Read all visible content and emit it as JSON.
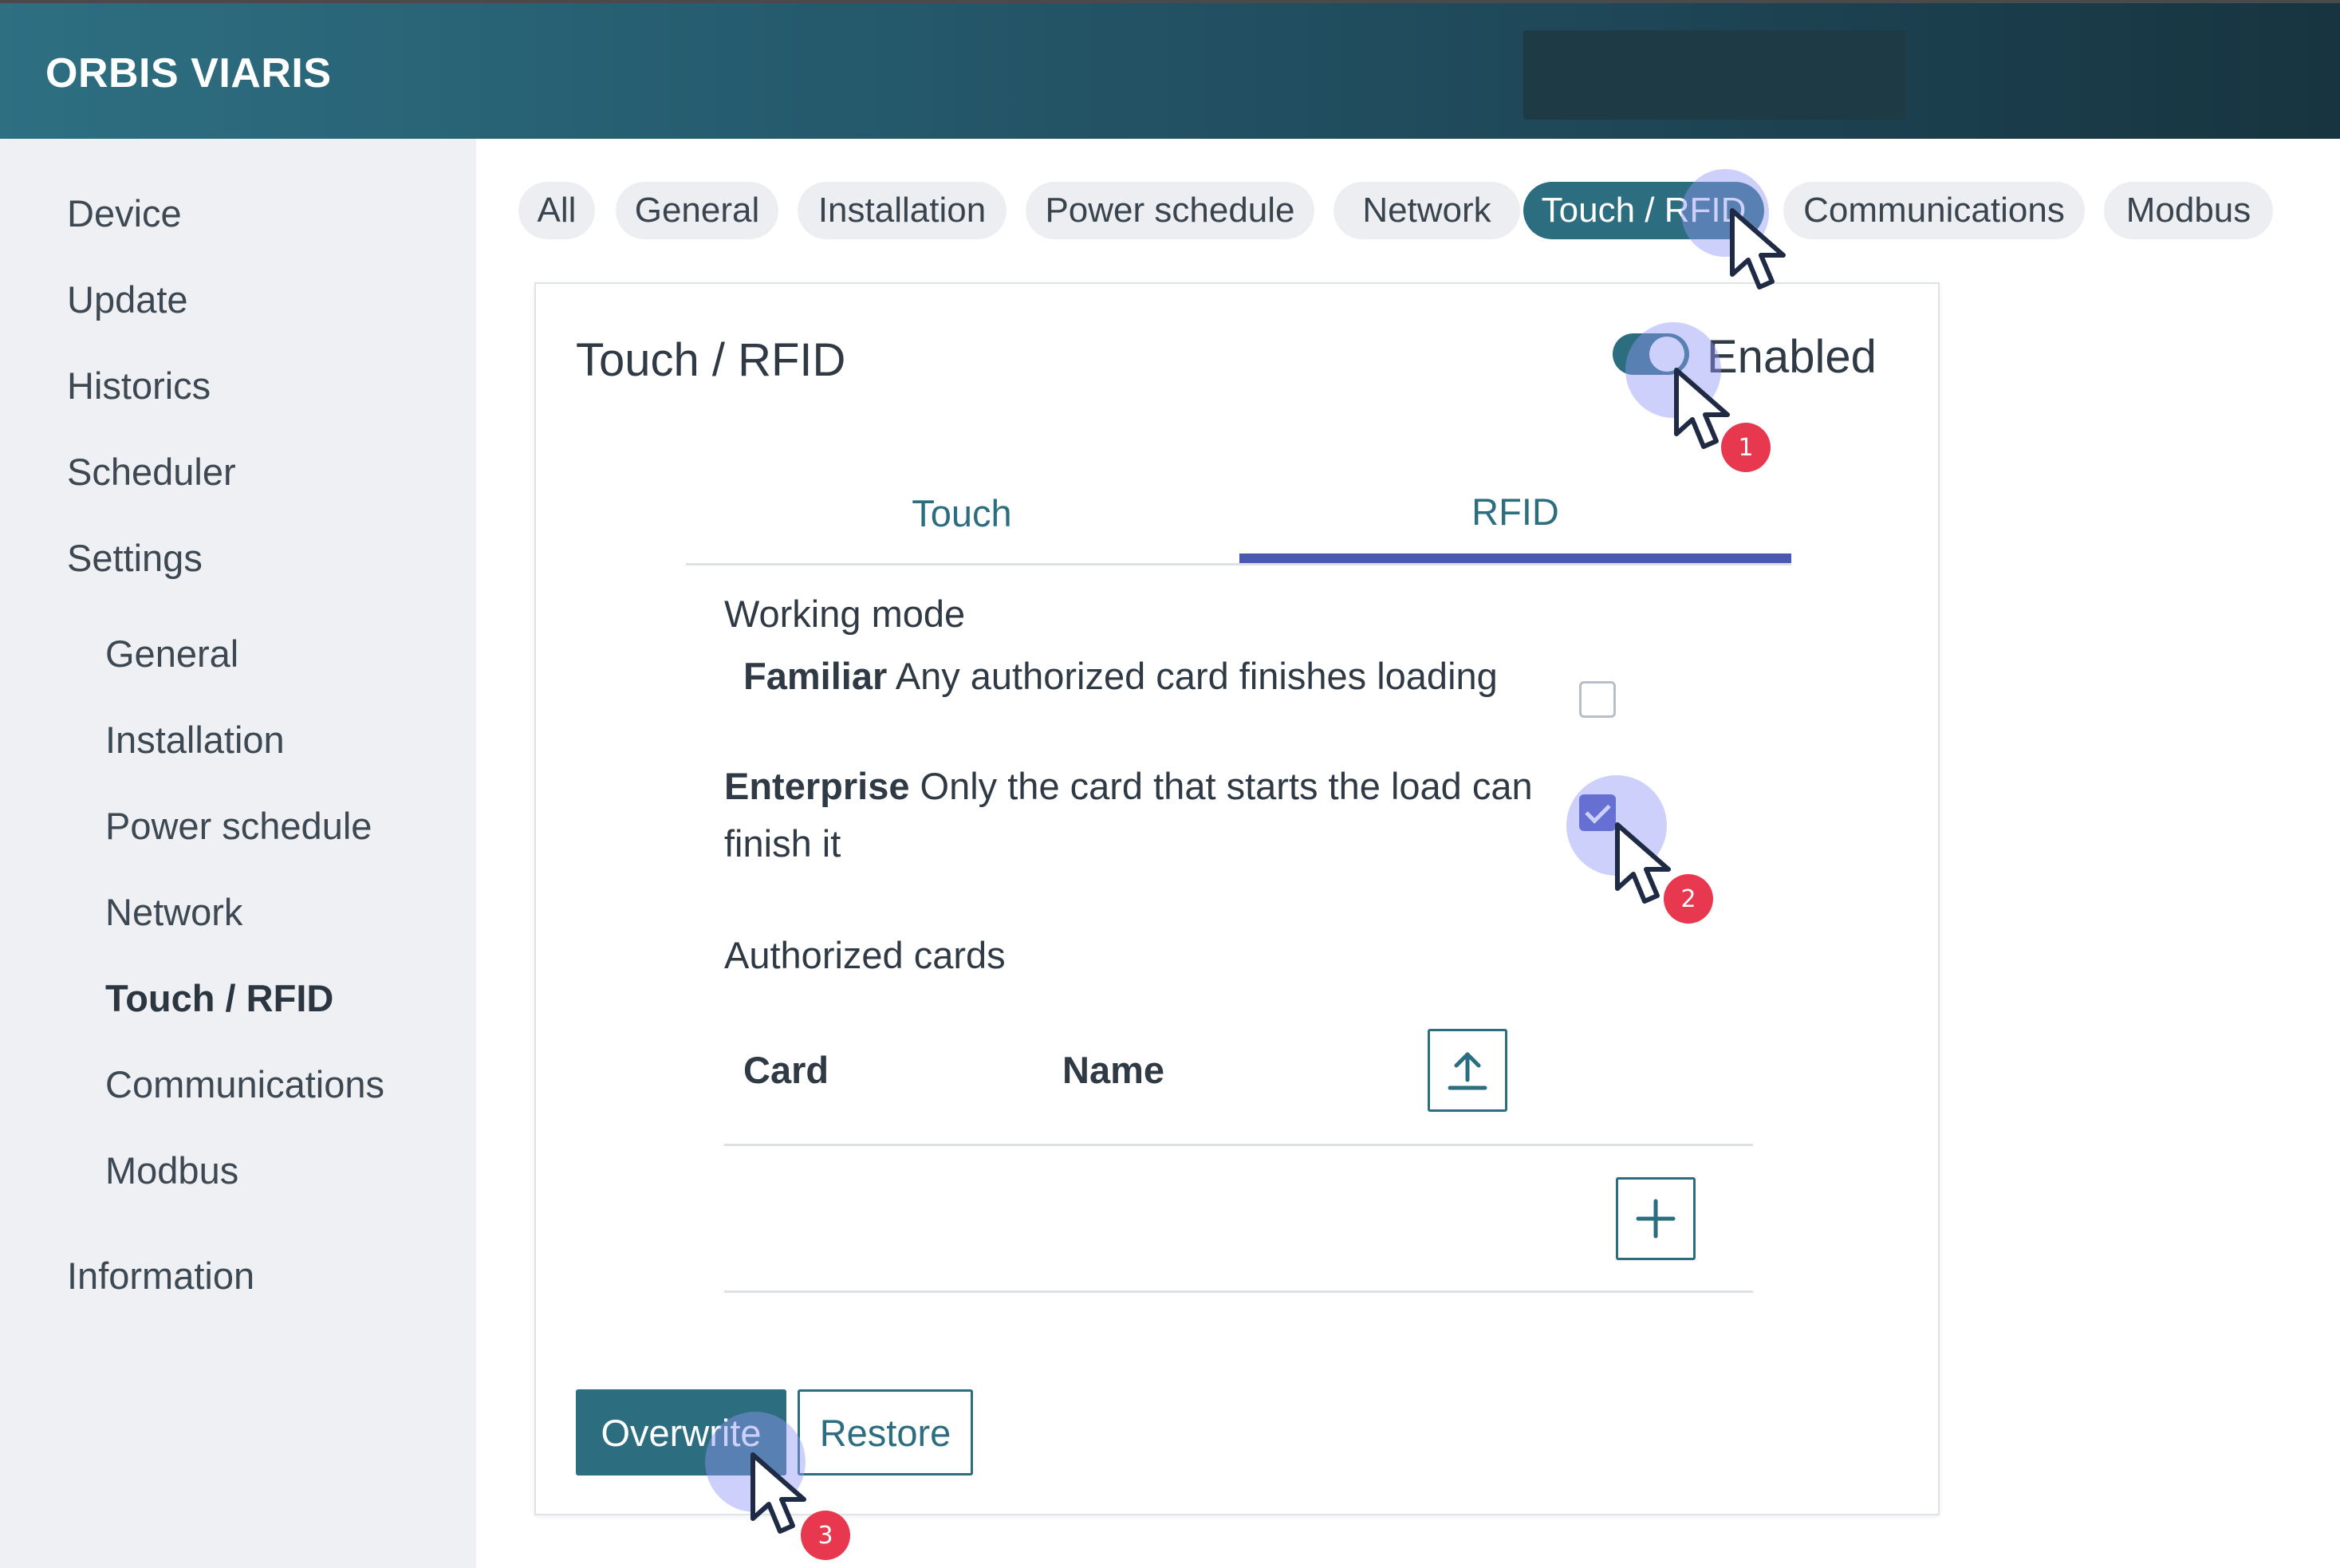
{
  "header": {
    "brand": "ORBIS VIARIS"
  },
  "sidebar": {
    "items": [
      {
        "label": "Device"
      },
      {
        "label": "Update"
      },
      {
        "label": "Historics"
      },
      {
        "label": "Scheduler"
      },
      {
        "label": "Settings"
      }
    ],
    "settings_items": [
      {
        "label": "General"
      },
      {
        "label": "Installation"
      },
      {
        "label": "Power schedule"
      },
      {
        "label": "Network"
      },
      {
        "label": "Touch / RFID",
        "active": true
      },
      {
        "label": "Communications"
      },
      {
        "label": "Modbus"
      }
    ],
    "footer_item": {
      "label": "Information"
    }
  },
  "filters": [
    {
      "label": "All"
    },
    {
      "label": "General"
    },
    {
      "label": "Installation"
    },
    {
      "label": "Power schedule"
    },
    {
      "label": "Network"
    },
    {
      "label": "Touch / RFID",
      "active": true
    },
    {
      "label": "Communications"
    },
    {
      "label": "Modbus"
    }
  ],
  "panel": {
    "title": "Touch / RFID",
    "toggle": {
      "label": "Enabled",
      "on": true
    },
    "tabs": [
      {
        "label": "Touch"
      },
      {
        "label": "RFID",
        "active": true
      }
    ],
    "working_mode": {
      "label": "Working mode",
      "options": [
        {
          "name": "Familiar",
          "description": "Any authorized card finishes loading",
          "checked": false
        },
        {
          "name": "Enterprise",
          "description": "Only the card that starts the load can finish it",
          "checked": true
        }
      ]
    },
    "authorized_cards": {
      "label": "Authorized cards",
      "columns": [
        "Card",
        "Name"
      ]
    },
    "buttons": {
      "overwrite": "Overwrite",
      "restore": "Restore"
    }
  },
  "annotations": {
    "steps": [
      "1",
      "2",
      "3"
    ]
  },
  "colors": {
    "accent": "#2c6e7f",
    "tab_indicator": "#4a58b0",
    "checkbox": "#4450b8",
    "badge": "#e8384f"
  }
}
